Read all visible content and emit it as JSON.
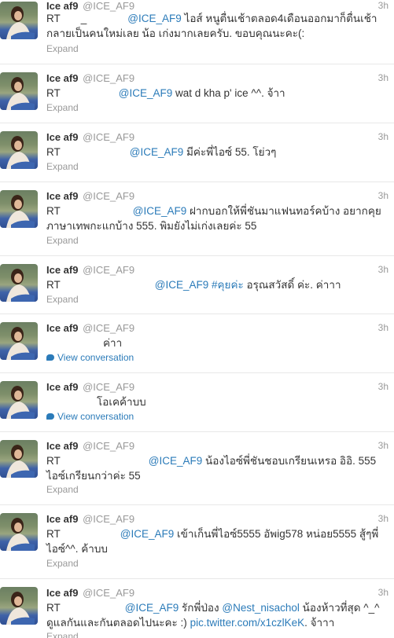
{
  "tweets": [
    {
      "name": "Ice af9",
      "handle": "@ICE_AF9",
      "time": "3h",
      "lines": [
        {
          "rt": "RT",
          "user": "_",
          "mention": "@ICE_AF9",
          "text": "ไอส์ หนูตื่นเช้าตลอด4เดือนออกมาก็ตื่นเช้า"
        },
        {
          "text": "กลายเป็นคนใหม่เลย น้อ เก่งมากเลยครับ. ขอบคุณนะคะ(:"
        }
      ],
      "action": "Expand"
    },
    {
      "name": "Ice af9",
      "handle": "@ICE_AF9",
      "time": "3h",
      "lines": [
        {
          "rt": "RT",
          "mention": "@ICE_AF9",
          "text": "wat d kha p' ice ^^. จ้าา"
        }
      ],
      "action": "Expand"
    },
    {
      "name": "Ice af9",
      "handle": "@ICE_AF9",
      "time": "3h",
      "lines": [
        {
          "rt": "RT",
          "mention": "@ICE_AF9",
          "text": "มีค่ะพี่ไอซ์ 55. โย่วๆ"
        }
      ],
      "action": "Expand"
    },
    {
      "name": "Ice af9",
      "handle": "@ICE_AF9",
      "time": "3h",
      "lines": [
        {
          "rt": "RT",
          "mention": "@ICE_AF9",
          "text": "ฝากบอกให้พี่ชันมาแฟนทอร์คบ้าง อยากคุย"
        },
        {
          "text": "ภาษาเทพกะแกบ้าง 555. พิมยังไม่เก่งเลยค่ะ 55"
        }
      ],
      "action": "Expand"
    },
    {
      "name": "Ice af9",
      "handle": "@ICE_AF9",
      "time": "3h",
      "lines": [
        {
          "rt": "RT",
          "mention": "@ICE_AF9",
          "hashtag": "#คุยค่ะ",
          "text": "อรุณสวัสดิ์ ค่ะ. ค่าาา"
        }
      ],
      "action": "Expand"
    },
    {
      "name": "Ice af9",
      "handle": "@ICE_AF9",
      "time": "3h",
      "lines": [
        {
          "text": "ค่าา"
        }
      ],
      "action": "View conversation"
    },
    {
      "name": "Ice af9",
      "handle": "@ICE_AF9",
      "time": "3h",
      "lines": [
        {
          "text": "โอเคค้าบบ"
        }
      ],
      "action": "View conversation"
    },
    {
      "name": "Ice af9",
      "handle": "@ICE_AF9",
      "time": "3h",
      "lines": [
        {
          "rt": "RT",
          "mention": "@ICE_AF9",
          "text": "น้องไอซ์พี่ชันชอบเกรียนเหรอ อิอิ. 555"
        },
        {
          "text": "ไอซ์เกรียนกว่าค่ะ 55"
        }
      ],
      "action": "Expand"
    },
    {
      "name": "Ice af9",
      "handle": "@ICE_AF9",
      "time": "3h",
      "lines": [
        {
          "rt": "RT",
          "mention": "@ICE_AF9",
          "text": "เข้าเก็นพี่ไอซ์5555 อัพig578 หน่อย5555 สู้ๆพี่"
        },
        {
          "text": "ไอซ์^^. ค้าบบ"
        }
      ],
      "action": "Expand"
    },
    {
      "name": "Ice af9",
      "handle": "@ICE_AF9",
      "time": "3h",
      "lines": [
        {
          "rt": "RT",
          "mention": "@ICE_AF9",
          "text": "รักพี่ป่อง",
          "mention2": "@Nest_nisachol",
          "text2": "น้องห้าวที่สุด ^_^"
        },
        {
          "text": "ดูแลกันและกันตลอดไปนะคะ :)",
          "link": "pic.twitter.com/x1czlKeK",
          "text2": ". จ้าาา"
        }
      ],
      "action": "Expand"
    }
  ]
}
